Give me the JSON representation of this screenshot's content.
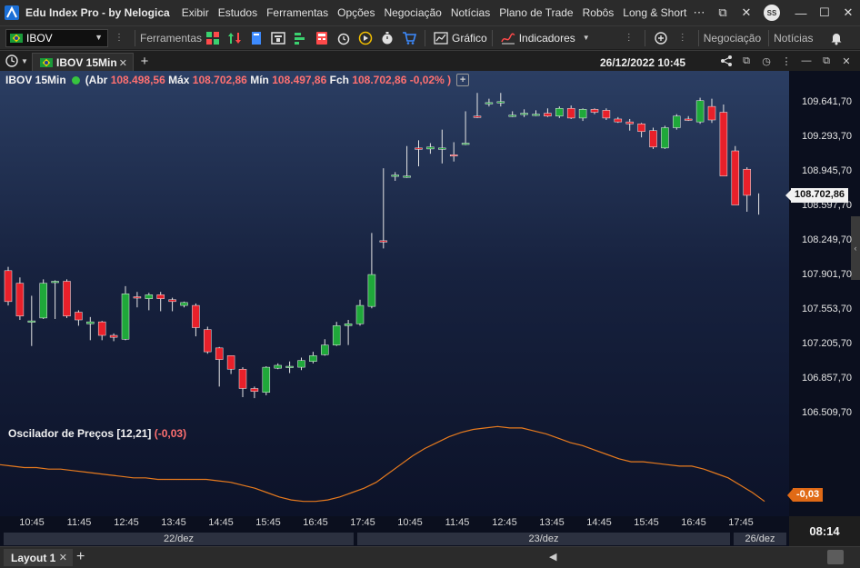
{
  "titlebar": {
    "app_title": "Edu Index Pro - by Nelogica",
    "menu": [
      "Exibir",
      "Estudos",
      "Ferramentas",
      "Opções",
      "Negociação",
      "Notícias",
      "Plano de Trade",
      "Robôs",
      "Long & Short"
    ],
    "user_initials": "SS",
    "icons": [
      "nelogica-logo-icon",
      "more-dots-icon",
      "minimize-icon",
      "restore-icon",
      "close-icon",
      "avatar"
    ]
  },
  "toolbar": {
    "symbol": "IBOV",
    "labels": {
      "ferramentas": "Ferramentas",
      "grafico": "Gráfico",
      "indicadores": "Indicadores",
      "negociacao": "Negociação",
      "noticias": "Notícias"
    },
    "icons": [
      "brazil-flag-icon",
      "drawing-tools-icon",
      "updown-arrows-icon",
      "bookmark-icon",
      "tape-icon",
      "ladder-icon",
      "calculator-icon",
      "play-icon",
      "alarm-icon",
      "cart-icon",
      "chart-icon",
      "indicator-icon",
      "add-window-icon",
      "bell-icon"
    ],
    "colors": {
      "accent_green": "#3bd16f",
      "accent_red": "#ff4a4a",
      "accent_blue": "#3d8bff"
    }
  },
  "tabbar": {
    "tab_label": "IBOV 15Min",
    "datetime": "26/12/2022 10:45"
  },
  "chart_header": {
    "symbol": "IBOV 15Min",
    "abr_label": "(Abr",
    "abr": "108.498,56",
    "max_label": "Máx",
    "max": "108.702,86",
    "min_label": "Mín",
    "min": "108.497,86",
    "fch_label": "Fch",
    "fch": "108.702,86",
    "change": "-0,02% )"
  },
  "oscillator": {
    "name": "Oscilador de Preços [12,21]",
    "value": "(-0,03)",
    "tag": "-0,03",
    "color": "#e67a1e"
  },
  "price_axis": {
    "ticks": [
      "109.641,70",
      "109.293,70",
      "108.945,70",
      "108.597,70",
      "108.249,70",
      "107.901,70",
      "107.553,70",
      "107.205,70",
      "106.857,70",
      "106.509,70"
    ],
    "current": "108.702,86"
  },
  "time_axis": {
    "labels": [
      "10:45",
      "11:45",
      "12:45",
      "13:45",
      "14:45",
      "15:45",
      "16:45",
      "17:45",
      "10:45",
      "11:45",
      "12:45",
      "13:45",
      "14:45",
      "15:45",
      "16:45",
      "17:45"
    ],
    "dates": [
      "22/dez",
      "23/dez",
      "26/dez"
    ],
    "clock": "08:14"
  },
  "bottombar": {
    "layout_tab": "Layout 1"
  },
  "chart_data": [
    {
      "type": "candlestick",
      "title": "IBOV 15Min",
      "ylim": [
        106300,
        109800
      ],
      "up_color": "#1fa83a",
      "down_color": "#e8202a",
      "categories": [
        "22/dez 10:15",
        "10:30",
        "10:45",
        "11:00",
        "11:15",
        "11:30",
        "11:45",
        "12:00",
        "12:15",
        "12:30",
        "12:45",
        "13:00",
        "13:15",
        "13:30",
        "13:45",
        "14:00",
        "14:15",
        "14:30",
        "14:45",
        "15:00",
        "15:15",
        "15:30",
        "15:45",
        "16:00",
        "16:15",
        "16:30",
        "16:45",
        "17:00",
        "17:15",
        "17:30",
        "17:45",
        "18:00",
        "23/dez 10:00",
        "10:15",
        "10:30",
        "10:45",
        "11:00",
        "11:15",
        "11:30",
        "11:45",
        "12:00",
        "12:15",
        "12:30",
        "12:45",
        "13:00",
        "13:15",
        "13:30",
        "13:45",
        "14:00",
        "14:15",
        "14:30",
        "14:45",
        "15:00",
        "15:15",
        "15:30",
        "15:45",
        "16:00",
        "16:15",
        "16:30",
        "16:45",
        "17:00",
        "17:15",
        "17:30",
        "17:45",
        "26/dez 10:00",
        "10:15",
        "10:30",
        "10:45"
      ],
      "open": [
        107920,
        107790,
        107400,
        107430,
        107810,
        107810,
        107490,
        107370,
        107390,
        107250,
        107210,
        107650,
        107630,
        107670,
        107620,
        107560,
        107560,
        107310,
        107120,
        107040,
        106900,
        106700,
        106660,
        106910,
        106920,
        106920,
        106980,
        107050,
        107150,
        107350,
        107370,
        107550,
        108230,
        108900,
        108890,
        109190,
        109180,
        109190,
        109120,
        109240,
        109520,
        109660,
        109660,
        109520,
        109550,
        109530,
        109550,
        109520,
        109600,
        109500,
        109590,
        109580,
        109490,
        109460,
        109440,
        109370,
        109190,
        109400,
        109490,
        109460,
        109620,
        109560,
        109160,
        108970,
        108900
      ],
      "close": [
        107600,
        107450,
        107400,
        107790,
        107810,
        107450,
        107410,
        107390,
        107250,
        107230,
        107680,
        107640,
        107670,
        107630,
        107600,
        107590,
        107330,
        107080,
        107000,
        106900,
        106700,
        106670,
        106920,
        106940,
        106930,
        106990,
        107040,
        107150,
        107350,
        107370,
        107560,
        107880,
        108220,
        108910,
        108900,
        109180,
        109200,
        109190,
        109110,
        109240,
        109510,
        109660,
        109670,
        109530,
        109550,
        109540,
        109520,
        109600,
        109500,
        109590,
        109560,
        109500,
        109460,
        109440,
        109360,
        109200,
        109400,
        109520,
        109480,
        109680,
        109480,
        108900,
        108600,
        108700
      ],
      "high": [
        107960,
        107850,
        107660,
        107830,
        107820,
        107830,
        107510,
        107440,
        107400,
        107270,
        107760,
        107700,
        107690,
        107700,
        107640,
        107600,
        107580,
        107340,
        107130,
        107040,
        106920,
        106720,
        106930,
        106960,
        106980,
        107020,
        107080,
        107210,
        107390,
        107410,
        107620,
        108310,
        108980,
        108940,
        109210,
        109270,
        109240,
        109380,
        109250,
        109570,
        109760,
        109700,
        109760,
        109570,
        109590,
        109580,
        109600,
        109620,
        109630,
        109600,
        109600,
        109600,
        109510,
        109490,
        109450,
        109400,
        109420,
        109540,
        109520,
        109710,
        109700,
        109640,
        109210,
        108990,
        108720
      ],
      "low": [
        107560,
        107410,
        107140,
        107420,
        107420,
        107430,
        107350,
        107200,
        107200,
        107190,
        107200,
        107540,
        107510,
        107500,
        107500,
        107540,
        107240,
        107060,
        106720,
        106850,
        106610,
        106600,
        106630,
        106900,
        106860,
        106890,
        106960,
        107040,
        107140,
        107150,
        107350,
        107530,
        108150,
        108850,
        108880,
        109000,
        109130,
        109030,
        109050,
        109220,
        109500,
        109620,
        109620,
        109510,
        109510,
        109520,
        109510,
        109500,
        109490,
        109470,
        109540,
        109480,
        109450,
        109370,
        109300,
        109180,
        109180,
        109380,
        109470,
        109440,
        109450,
        109300,
        108860,
        108530,
        108500
      ]
    },
    {
      "type": "line",
      "series": [
        {
          "name": "Oscilador de Preços [12,21]",
          "values": [
            0.22,
            0.21,
            0.2,
            0.2,
            0.19,
            0.19,
            0.18,
            0.17,
            0.16,
            0.15,
            0.14,
            0.13,
            0.13,
            0.12,
            0.12,
            0.12,
            0.12,
            0.12,
            0.11,
            0.1,
            0.08,
            0.06,
            0.03,
            0.0,
            -0.02,
            -0.03,
            -0.03,
            -0.02,
            0.0,
            0.03,
            0.06,
            0.1,
            0.16,
            0.22,
            0.28,
            0.33,
            0.37,
            0.41,
            0.44,
            0.46,
            0.47,
            0.48,
            0.47,
            0.47,
            0.45,
            0.43,
            0.4,
            0.37,
            0.35,
            0.32,
            0.29,
            0.26,
            0.24,
            0.24,
            0.23,
            0.22,
            0.21,
            0.21,
            0.19,
            0.16,
            0.13,
            0.08,
            0.03,
            -0.03
          ]
        }
      ],
      "ylim": [
        -0.1,
        0.55
      ]
    }
  ]
}
